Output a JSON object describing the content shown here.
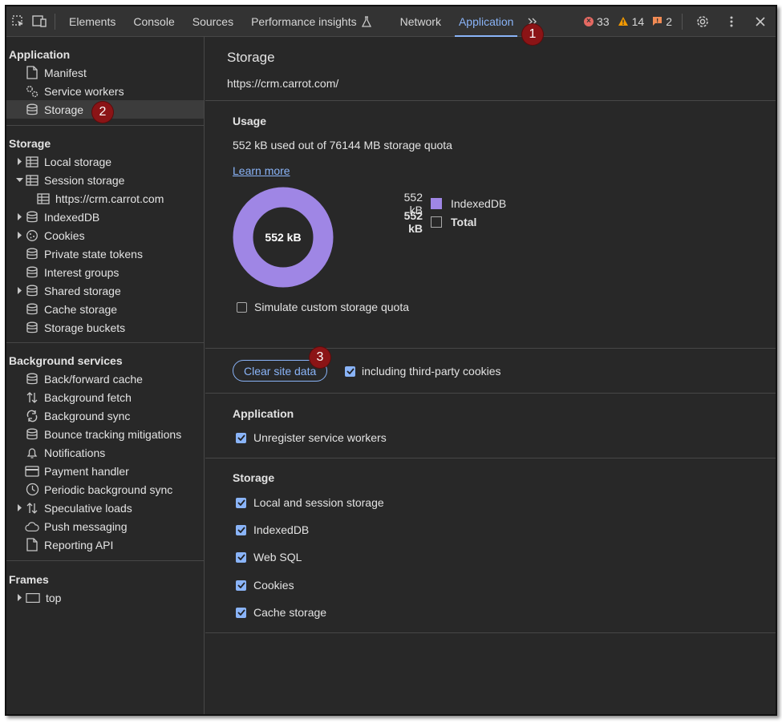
{
  "toolbar": {
    "tabs": [
      "Elements",
      "Console",
      "Sources",
      "Performance insights",
      "Network",
      "Application"
    ],
    "active_tab": "Application",
    "errors": "33",
    "warnings": "14",
    "issues": "2"
  },
  "sidebar": {
    "application": {
      "title": "Application",
      "items": [
        "Manifest",
        "Service workers",
        "Storage"
      ]
    },
    "storage": {
      "title": "Storage",
      "items": [
        "Local storage",
        "Session storage",
        "https://crm.carrot.com",
        "IndexedDB",
        "Cookies",
        "Private state tokens",
        "Interest groups",
        "Shared storage",
        "Cache storage",
        "Storage buckets"
      ]
    },
    "background": {
      "title": "Background services",
      "items": [
        "Back/forward cache",
        "Background fetch",
        "Background sync",
        "Bounce tracking mitigations",
        "Notifications",
        "Payment handler",
        "Periodic background sync",
        "Speculative loads",
        "Push messaging",
        "Reporting API"
      ]
    },
    "frames": {
      "title": "Frames",
      "items": [
        "top"
      ]
    }
  },
  "main": {
    "title": "Storage",
    "url": "https://crm.carrot.com/",
    "usage": {
      "heading": "Usage",
      "summary": "552 kB used out of 76144 MB storage quota",
      "learn_more": "Learn more",
      "donut_label": "552 kB",
      "legend": [
        {
          "value": "552 kB",
          "name": "IndexedDB",
          "color": "#9f86e5"
        },
        {
          "value": "552 kB",
          "name": "Total",
          "color": "transparent"
        }
      ],
      "simulate_label": "Simulate custom storage quota"
    },
    "clear": {
      "button": "Clear site data",
      "third_party": "including third-party cookies"
    },
    "application": {
      "heading": "Application",
      "items": [
        "Unregister service workers"
      ]
    },
    "storage": {
      "heading": "Storage",
      "items": [
        "Local and session storage",
        "IndexedDB",
        "Web SQL",
        "Cookies",
        "Cache storage"
      ]
    }
  },
  "badges": [
    "1",
    "2",
    "3"
  ],
  "colors": {
    "accent": "#8ab4f8",
    "indexeddb": "#9f86e5",
    "badge": "#8b1416"
  }
}
